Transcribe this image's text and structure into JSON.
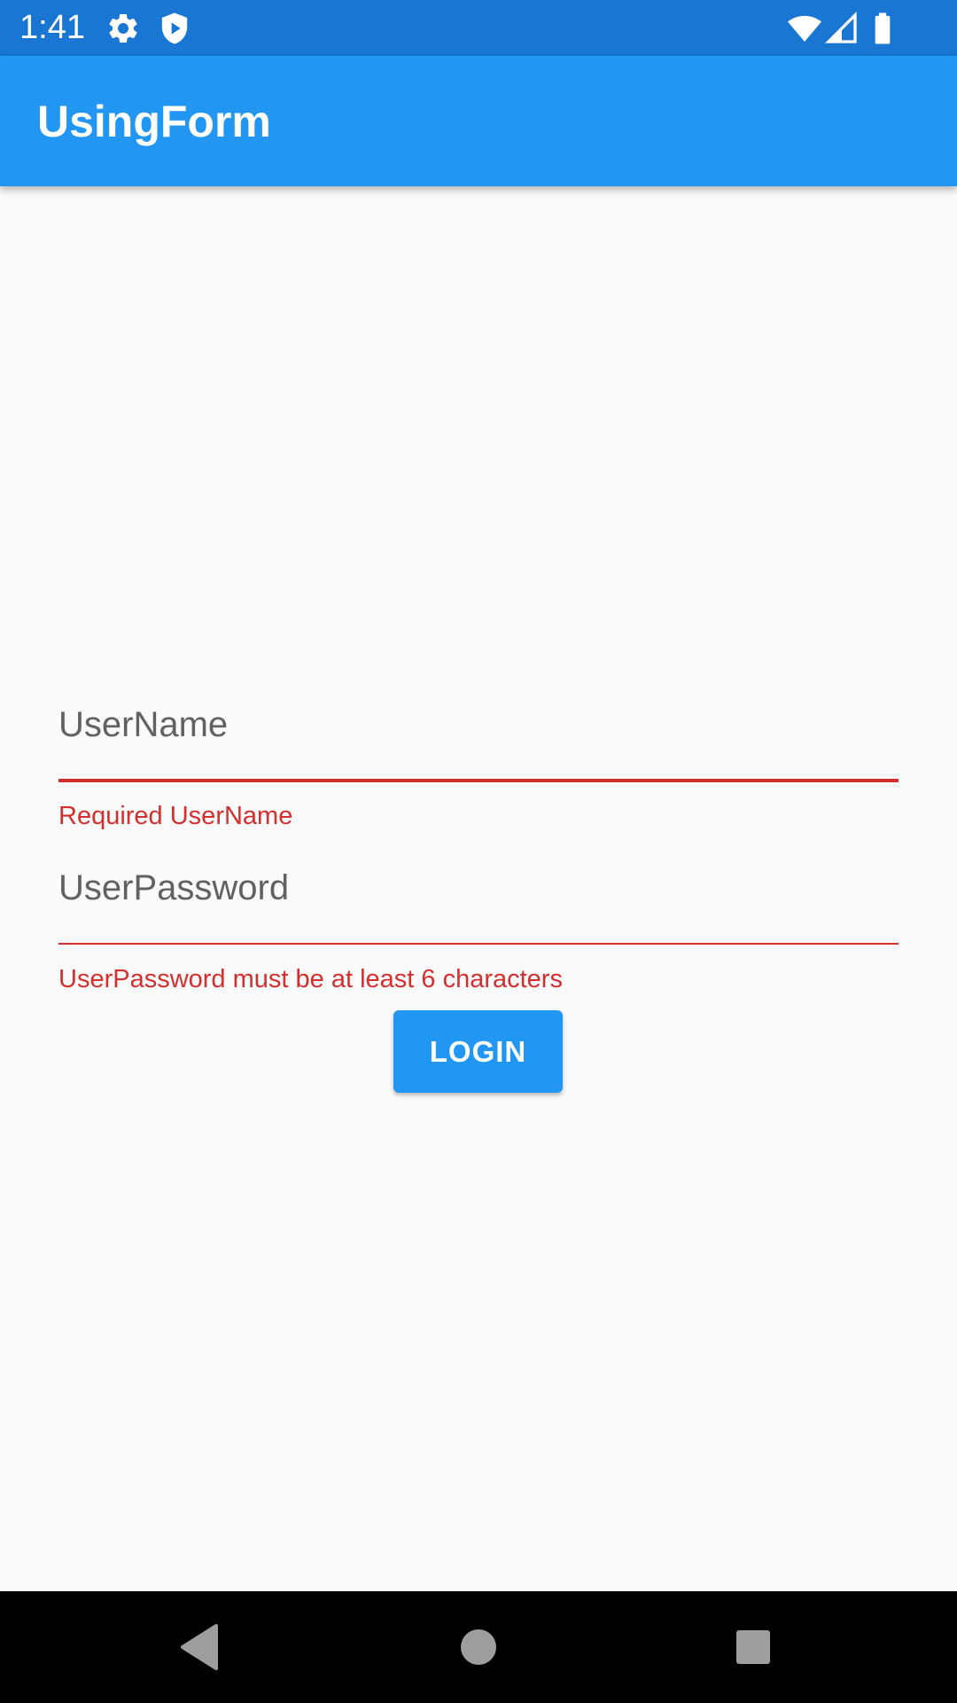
{
  "status_bar": {
    "time": "1:41",
    "icons": [
      "gear-icon",
      "shield-play-icon",
      "wifi-icon",
      "cell-signal-icon",
      "battery-icon"
    ]
  },
  "app_bar": {
    "title": "UsingForm"
  },
  "form": {
    "username": {
      "value": "",
      "placeholder": "UserName",
      "error": "Required UserName"
    },
    "password": {
      "value": "",
      "placeholder": "UserPassword",
      "error": "UserPassword must be at least 6 characters"
    },
    "login_label": "LOGIN"
  },
  "nav_bar": {
    "icons": [
      "back-icon",
      "home-icon",
      "recents-icon"
    ]
  },
  "colors": {
    "status_bar": "#1976d2",
    "app_bar": "#2196f3",
    "background": "#fafafa",
    "error": "#d32f2f",
    "button": "#2196f3",
    "nav_bar": "#000000"
  }
}
